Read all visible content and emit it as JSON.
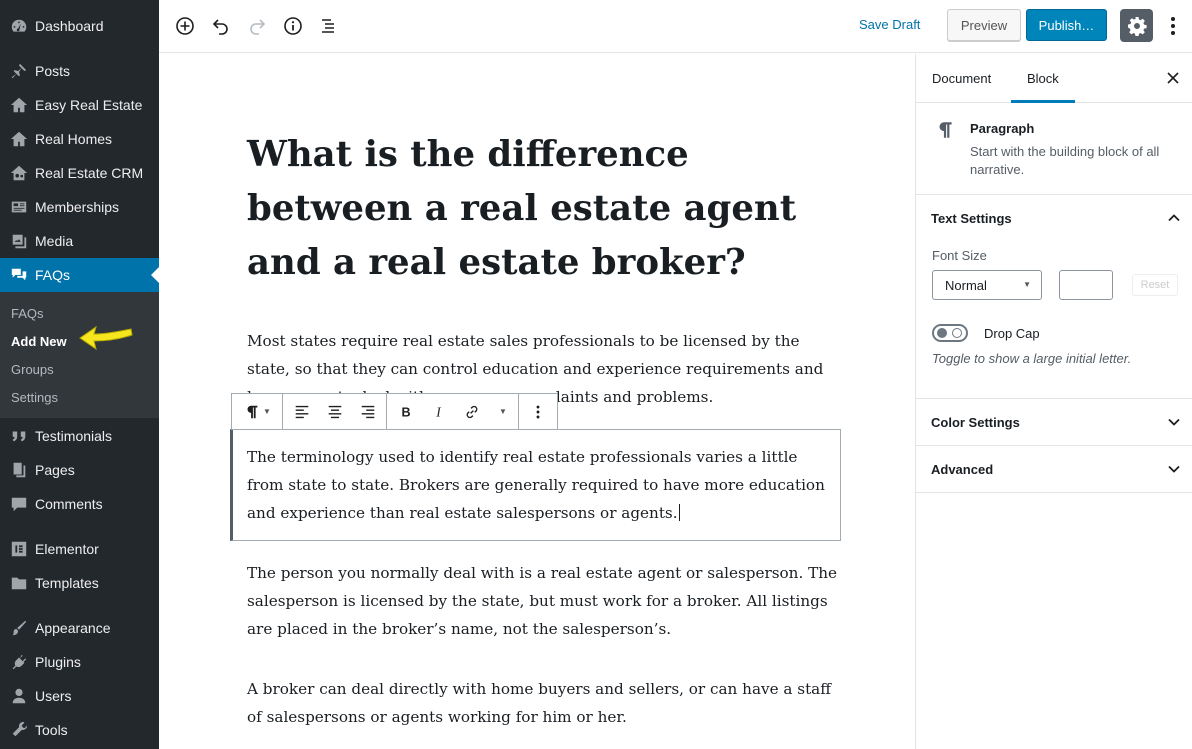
{
  "colors": {
    "admin_bg": "#23282d",
    "admin_submenu_bg": "#32373c",
    "admin_current": "#0073aa",
    "publish": "#0085ba",
    "annotation_arrow": "#f5e61d"
  },
  "sidebar": {
    "items": [
      {
        "label": "Dashboard",
        "icon": "dashboard-icon"
      },
      {
        "label": "Posts",
        "icon": "pin-icon"
      },
      {
        "label": "Easy Real Estate",
        "icon": "house-icon"
      },
      {
        "label": "Real Homes",
        "icon": "house-icon"
      },
      {
        "label": "Real Estate CRM",
        "icon": "house-people-icon"
      },
      {
        "label": "Memberships",
        "icon": "id-card-icon"
      },
      {
        "label": "Media",
        "icon": "media-icon"
      },
      {
        "label": "FAQs",
        "icon": "chat-bubbles-icon"
      },
      {
        "label": "Testimonials",
        "icon": "quote-icon"
      },
      {
        "label": "Pages",
        "icon": "pages-icon"
      },
      {
        "label": "Comments",
        "icon": "comment-icon"
      },
      {
        "label": "Elementor",
        "icon": "elementor-icon"
      },
      {
        "label": "Templates",
        "icon": "folder-icon"
      },
      {
        "label": "Appearance",
        "icon": "brush-icon"
      },
      {
        "label": "Plugins",
        "icon": "plug-icon"
      },
      {
        "label": "Users",
        "icon": "user-icon"
      },
      {
        "label": "Tools",
        "icon": "wrench-icon"
      }
    ],
    "submenu": [
      "FAQs",
      "Add New",
      "Groups",
      "Settings"
    ]
  },
  "topbar": {
    "save_draft": "Save Draft",
    "preview": "Preview",
    "publish": "Publish…"
  },
  "editor": {
    "title": "What is the difference between a real estate agent and a real estate broker?",
    "paragraphs": [
      "Most states require real estate sales professionals to be licensed by the state, so that they can control education and experience requirements and have a way to deal with consumer complaints and problems.",
      "The terminology used to identify real estate professionals varies a little from state to state. Brokers are generally required to have more education and experience than real estate salespersons or agents.",
      "The person you normally deal with is a real estate agent or salesperson. The salesperson is licensed by the state, but must work for a broker. All listings are placed in the broker’s name, not the salesperson’s.",
      "A broker can deal directly with home buyers and sellers, or can have a staff of salespersons or agents working for him or her."
    ]
  },
  "settings_panel": {
    "tabs": [
      "Document",
      "Block"
    ],
    "active_tab": "Block",
    "block_card": {
      "title": "Paragraph",
      "description": "Start with the building block of all narrative."
    },
    "text_settings": {
      "heading": "Text Settings",
      "font_size_label": "Font Size",
      "font_size_value": "Normal",
      "reset_label": "Reset",
      "drop_cap_label": "Drop Cap",
      "drop_cap_help": "Toggle to show a large initial letter."
    },
    "color_settings": "Color Settings",
    "advanced": "Advanced"
  }
}
